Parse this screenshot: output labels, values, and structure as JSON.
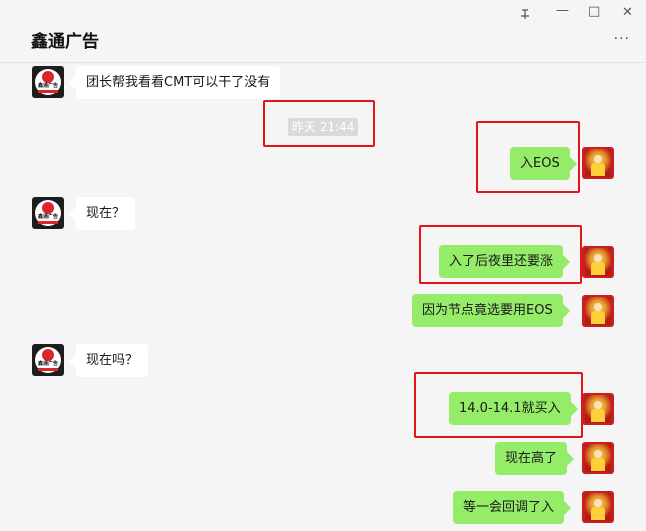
{
  "window": {
    "title": "鑫通广告",
    "pin_icon": "pin-icon",
    "minimize_glyph": "—",
    "maximize_glyph": "□",
    "close_glyph": "✕",
    "more_glyph": "···"
  },
  "avatars": {
    "left_text": "鑫通广告"
  },
  "messages": [
    {
      "side": "left",
      "text": "团长帮我看看CMT可以干了没有"
    },
    {
      "side": "time",
      "text": "昨天 21:44"
    },
    {
      "side": "right",
      "text": "入EOS"
    },
    {
      "side": "left",
      "text": "现在？"
    },
    {
      "side": "right",
      "text": "入了后夜里还要涨"
    },
    {
      "side": "right",
      "text": "因为节点竟选要用EOS"
    },
    {
      "side": "left",
      "text": "现在吗？"
    },
    {
      "side": "right",
      "text": "14.0-14.1就买入"
    },
    {
      "side": "right",
      "text": "现在高了"
    },
    {
      "side": "right",
      "text": "等一会回调了入"
    }
  ],
  "colors": {
    "bubble_right": "#95ec69",
    "bubble_left": "#ffffff",
    "highlight_box": "#e3141b"
  }
}
